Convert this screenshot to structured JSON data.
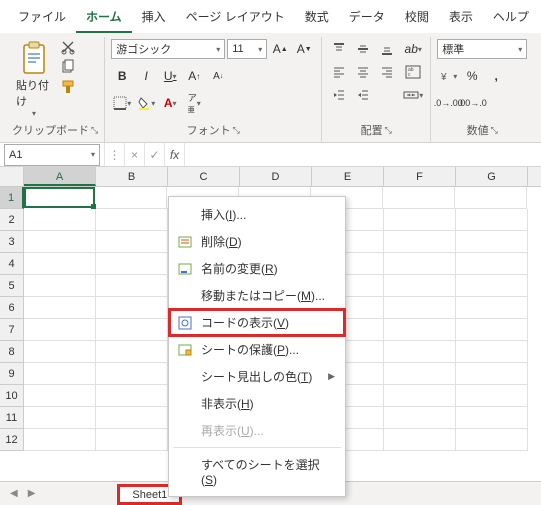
{
  "menubar": [
    "ファイル",
    "ホーム",
    "挿入",
    "ページ レイアウト",
    "数式",
    "データ",
    "校閲",
    "表示",
    "ヘルプ"
  ],
  "menubar_active": 1,
  "ribbon": {
    "clipboard": {
      "label": "クリップボード",
      "paste": "貼り付け"
    },
    "font": {
      "label": "フォント",
      "name": "游ゴシック",
      "size": "11"
    },
    "alignment": {
      "label": "配置"
    },
    "number": {
      "label": "数値",
      "format": "標準"
    }
  },
  "namebox": "A1",
  "columns": [
    "A",
    "B",
    "C",
    "D",
    "E",
    "F",
    "G"
  ],
  "rows": [
    "1",
    "2",
    "3",
    "4",
    "5",
    "6",
    "7",
    "8",
    "9",
    "10",
    "11",
    "12"
  ],
  "active_cell": {
    "row": 0,
    "col": 0
  },
  "sheet": {
    "name": "Sheet1"
  },
  "context_menu": {
    "insert": "挿入(I)...",
    "delete": "削除(D)",
    "rename": "名前の変更(R)",
    "move": "移動またはコピー(M)...",
    "view_code": "コードの表示(V)",
    "protect": "シートの保護(P)...",
    "tab_color": "シート見出しの色(T)",
    "hide": "非表示(H)",
    "unhide": "再表示(U)...",
    "select_all": "すべてのシートを選択(S)"
  }
}
